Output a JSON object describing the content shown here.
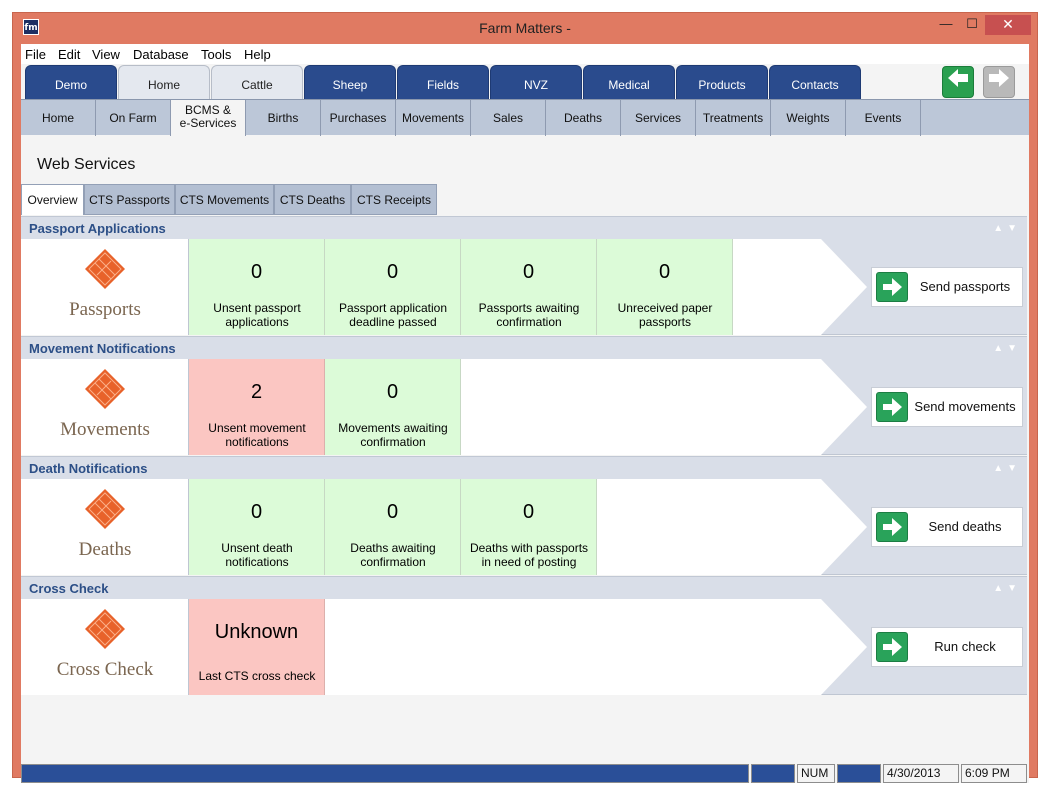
{
  "window": {
    "title": "Farm Matters -",
    "icon_label": "fm",
    "controls": {
      "minimize": "—",
      "maximize": "☐",
      "close": "✕"
    }
  },
  "menubar": [
    "File",
    "Edit",
    "View",
    "Database",
    "Tools",
    "Help"
  ],
  "main_tabs": [
    "Demo",
    "Home",
    "Cattle",
    "Sheep",
    "Fields",
    "NVZ",
    "Medical",
    "Products",
    "Contacts"
  ],
  "nav": {
    "back_icon": "arrow-left-icon",
    "forward_icon": "arrow-right-icon"
  },
  "sub_tabs": [
    "Home",
    "On Farm",
    "BCMS &\ne-Services",
    "Births",
    "Purchases",
    "Movements",
    "Sales",
    "Deaths",
    "Services",
    "Treatments",
    "Weights",
    "Events"
  ],
  "page_title": "Web Services",
  "cts_tabs": [
    "Overview",
    "CTS Passports",
    "CTS Movements",
    "CTS Deaths",
    "CTS Receipts"
  ],
  "sections": [
    {
      "title": "Passport Applications",
      "icon_name": "Passports",
      "stats": [
        {
          "value": "0",
          "caption": "Unsent passport applications"
        },
        {
          "value": "0",
          "caption": "Passport application deadline passed"
        },
        {
          "value": "0",
          "caption": "Passports awaiting confirmation"
        },
        {
          "value": "0",
          "caption": "Unreceived paper passports"
        }
      ],
      "action": "Send passports"
    },
    {
      "title": "Movement Notifications",
      "icon_name": "Movements",
      "stats": [
        {
          "value": "2",
          "caption": "Unsent movement notifications",
          "alert": true
        },
        {
          "value": "0",
          "caption": "Movements awaiting confirmation"
        }
      ],
      "action": "Send movements"
    },
    {
      "title": "Death Notifications",
      "icon_name": "Deaths",
      "stats": [
        {
          "value": "0",
          "caption": "Unsent death notifications"
        },
        {
          "value": "0",
          "caption": "Deaths awaiting confirmation"
        },
        {
          "value": "0",
          "caption": "Deaths with passports in need of posting"
        }
      ],
      "action": "Send deaths"
    },
    {
      "title": "Cross Check",
      "icon_name": "Cross Check",
      "stats": [
        {
          "value": "Unknown",
          "caption": "Last CTS cross check",
          "alert": true
        }
      ],
      "action": "Run check"
    }
  ],
  "statusbar": {
    "num": "NUM",
    "date": "4/30/2013",
    "time": "6:09 PM"
  },
  "colors": {
    "accent": "#2a4b8d",
    "good": "#dcfbd8",
    "alert": "#fbc6c2",
    "go": "#29a35a",
    "frame": "#e07a62"
  }
}
